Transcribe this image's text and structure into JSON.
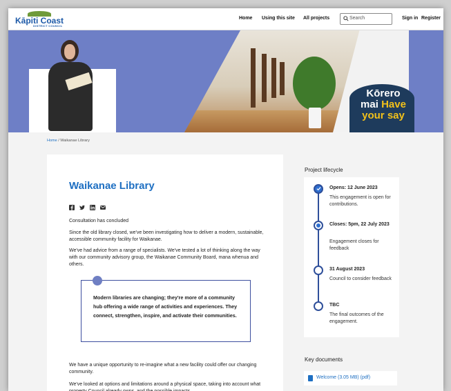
{
  "header": {
    "logo_name": "Kāpiti Coast",
    "logo_sub": "DISTRICT COUNCIL",
    "nav": [
      "Home",
      "Using this site",
      "All projects"
    ],
    "search_placeholder": "Search",
    "sign_in": "Sign in",
    "register": "Register"
  },
  "banner": {
    "line1": "Kōrero",
    "line2a": "mai",
    "line2b": "Have",
    "line3": "your say"
  },
  "breadcrumb": {
    "home": "Home",
    "sep": " / ",
    "current": "Waikanae Library"
  },
  "main": {
    "title": "Waikanae Library",
    "status": "Consultation has concluded",
    "para1": "Since the old library closed, we've been investigating how to deliver a modern, sustainable, accessible community facility for Waikanae.",
    "para2": "We've had advice from a range of specialists. We've tested a lot of thinking along the way with our community advisory group, the Waikanae Community Board, mana whenua and others.",
    "quote": "Modern libraries are changing; they're more of a community hub offering a wide range of activities and experiences. They connect, strengthen, inspire, and activate their communities.",
    "para3": "We have a unique opportunity to re-imagine what a new facility could offer our changing community.",
    "para4": "We've looked at options and limitations around a physical space, taking into account what property Council already owns, and the possible impacts"
  },
  "lifecycle": {
    "heading": "Project lifecycle",
    "stages": [
      {
        "title": "Opens: 12 June 2023",
        "desc": "This engagement is open for contributions."
      },
      {
        "title": "Closes: 5pm, 22 July 2023",
        "desc": "Engagement closes for feedback"
      },
      {
        "title": "31 August 2023",
        "desc": "Council to consider feedback"
      },
      {
        "title": "TBC",
        "desc": "The final outcomes of the engagement."
      }
    ]
  },
  "documents": {
    "heading": "Key documents",
    "items": [
      "Welcome (3.05 MB) (pdf)"
    ]
  },
  "colors": {
    "accent": "#1e6fc2",
    "banner": "#6e7fc6",
    "timeline": "#2e4f9a",
    "brand_yellow": "#f2c11a"
  }
}
